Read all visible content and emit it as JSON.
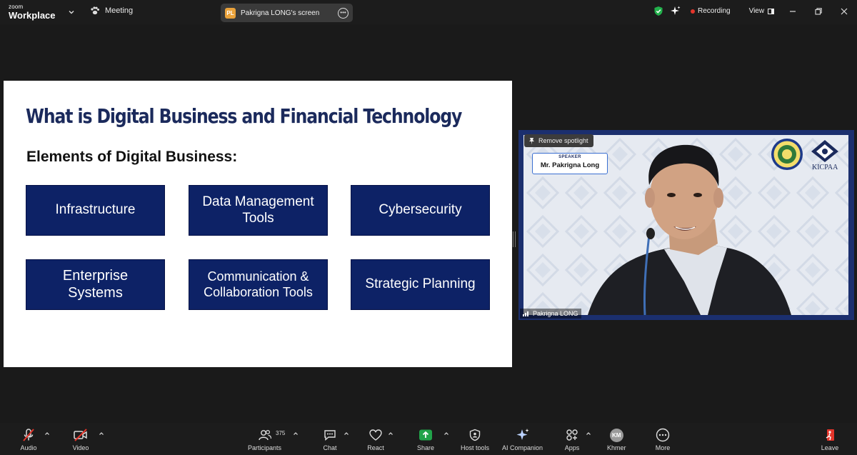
{
  "app": {
    "brand_small": "zoom",
    "brand_big": "Workplace",
    "meeting_label": "Meeting",
    "share_badge": "PL",
    "share_title": "Pakrigna LONG's screen",
    "recording_label": "Recording",
    "view_label": "View"
  },
  "slide": {
    "title": "What is Digital Business and Financial Technology",
    "subtitle": "Elements of Digital Business:",
    "elements": [
      "Infrastructure",
      "Data Management Tools",
      "Cybersecurity",
      "Enterprise Systems",
      "Communication & Collaboration Tools",
      "Strategic Planning"
    ]
  },
  "video": {
    "remove_spotlight": "Remove spotlight",
    "speaker_label": "SPEAKER",
    "speaker_name": "Mr. Pakrigna Long",
    "logo_text": "KICPAA",
    "participant_name": "Pakrigna LONG"
  },
  "toolbar": {
    "audio": "Audio",
    "video": "Video",
    "participants": "Participants",
    "participants_count": "375",
    "chat": "Chat",
    "react": "React",
    "share": "Share",
    "host_tools": "Host tools",
    "ai_companion": "AI Companion",
    "apps": "Apps",
    "khmer": "Khmer",
    "khmer_initials": "KM",
    "more": "More",
    "leave": "Leave"
  },
  "colors": {
    "slide_box": "#0d2266",
    "slide_title": "#1b2a5c",
    "share_green": "#21a34a",
    "leave_red": "#e3352b",
    "shield_green": "#22b04b"
  }
}
